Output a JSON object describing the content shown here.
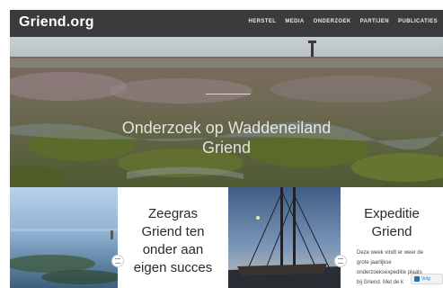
{
  "site": {
    "logo": "Griend.org"
  },
  "nav": {
    "items": [
      "HERSTEL",
      "MEDIA",
      "ONDERZOEK",
      "PARTIJEN",
      "PUBLICATIES"
    ]
  },
  "hero": {
    "title_line1": "Onderzoek op Waddeneiland",
    "title_line2": "Griend"
  },
  "cards": [
    {
      "title_line1": "Zeegras",
      "title_line2": "Griend ten",
      "title_line3": "onder aan",
      "title_line4": "eigen succes"
    },
    {
      "title_line1": "Expeditie",
      "title_line2": "Griend",
      "excerpt_line1": "Deze week vindt er weer de",
      "excerpt_line2": "grote jaarlijkse",
      "excerpt_line3": "onderzoeksexpeditie plaats",
      "excerpt_line4": "bij Griend. Met de k"
    }
  ],
  "follow": {
    "label": "Volg"
  },
  "colors": {
    "topbar": "#3a3b3d",
    "link": "#2271b1"
  }
}
